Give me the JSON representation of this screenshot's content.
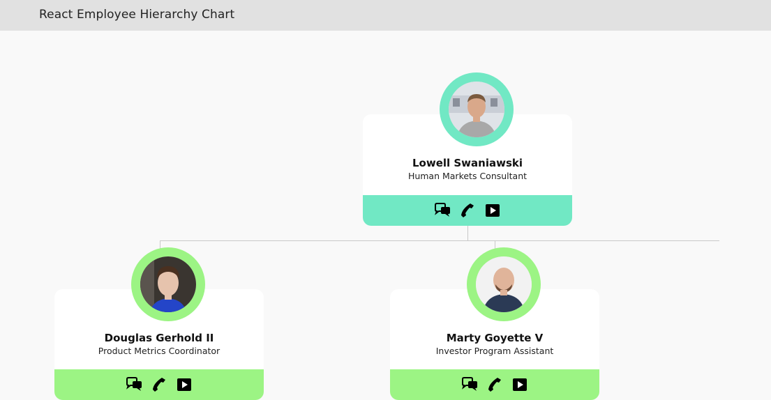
{
  "app": {
    "title": "React Employee Hierarchy Chart"
  },
  "colors": {
    "header_bg": "#e1e1e1",
    "root_accent": "#71e8c4",
    "child_accent": "#9cf484",
    "connector": "#c8c8c8"
  },
  "employees": [
    {
      "name": "Lowell Swaniawski",
      "role": "Human Markets Consultant",
      "accent": "root_accent",
      "actions": [
        "chat-icon",
        "phone-icon",
        "video-icon"
      ]
    },
    {
      "name": "Douglas Gerhold II",
      "role": "Product Metrics Coordinator",
      "accent": "child_accent",
      "actions": [
        "chat-icon",
        "phone-icon",
        "video-icon"
      ]
    },
    {
      "name": "Marty Goyette V",
      "role": "Investor Program Assistant",
      "accent": "child_accent",
      "actions": [
        "chat-icon",
        "phone-icon",
        "video-icon"
      ]
    }
  ]
}
